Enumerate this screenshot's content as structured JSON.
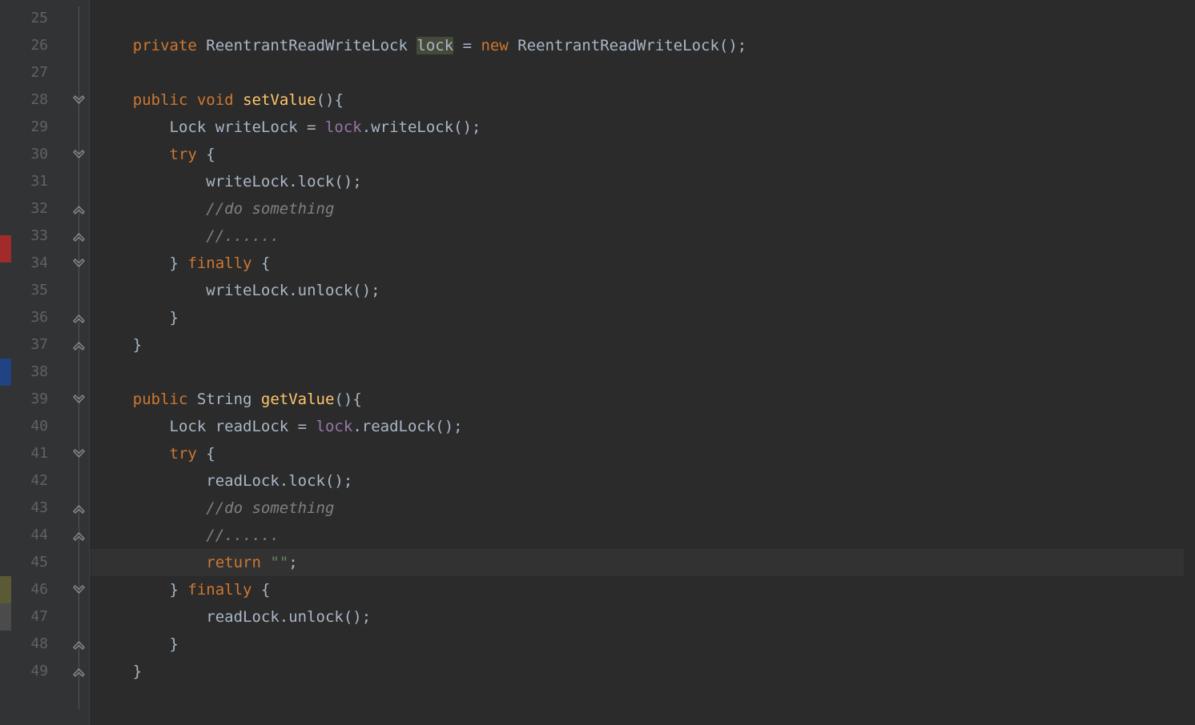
{
  "colors": {
    "keyword": "#cc7832",
    "identifier": "#a9b7c6",
    "function": "#ffc66d",
    "field": "#9876aa",
    "string": "#6a8759",
    "comment": "#808080",
    "highlight_word_bg": "#45493a",
    "line_highlight_bg": "#323232",
    "background": "#2b2b2b",
    "gutter_bg": "#313335"
  },
  "first_line_number": 25,
  "current_line_number": 45,
  "line_numbers": [
    "25",
    "26",
    "27",
    "28",
    "29",
    "30",
    "31",
    "32",
    "33",
    "34",
    "35",
    "36",
    "37",
    "38",
    "39",
    "40",
    "41",
    "42",
    "43",
    "44",
    "45",
    "46",
    "47",
    "48",
    "49"
  ],
  "strip_marks": [
    {
      "type": "red",
      "line": 33
    },
    {
      "type": "blue",
      "line": 38
    },
    {
      "type": "olive",
      "line": 46
    },
    {
      "type": "gray",
      "line": 47
    }
  ],
  "fold_markers": [
    {
      "line": 28,
      "kind": "open"
    },
    {
      "line": 30,
      "kind": "open"
    },
    {
      "line": 32,
      "kind": "close"
    },
    {
      "line": 33,
      "kind": "close"
    },
    {
      "line": 34,
      "kind": "open"
    },
    {
      "line": 36,
      "kind": "close"
    },
    {
      "line": 37,
      "kind": "close"
    },
    {
      "line": 39,
      "kind": "open"
    },
    {
      "line": 41,
      "kind": "open"
    },
    {
      "line": 43,
      "kind": "close"
    },
    {
      "line": 44,
      "kind": "close"
    },
    {
      "line": 46,
      "kind": "open"
    },
    {
      "line": 48,
      "kind": "close"
    },
    {
      "line": 49,
      "kind": "close"
    }
  ],
  "intention_bulb_line": 45,
  "code_lines": [
    {
      "n": 25,
      "tokens": []
    },
    {
      "n": 26,
      "tokens": [
        {
          "t": "    ",
          "c": "id"
        },
        {
          "t": "private",
          "c": "k"
        },
        {
          "t": " ReentrantReadWriteLock ",
          "c": "id"
        },
        {
          "t": "lock",
          "c": "id hlw"
        },
        {
          "t": " = ",
          "c": "id"
        },
        {
          "t": "new",
          "c": "k"
        },
        {
          "t": " ReentrantReadWriteLock();",
          "c": "id"
        }
      ]
    },
    {
      "n": 27,
      "tokens": []
    },
    {
      "n": 28,
      "tokens": [
        {
          "t": "    ",
          "c": "id"
        },
        {
          "t": "public",
          "c": "k"
        },
        {
          "t": " ",
          "c": "id"
        },
        {
          "t": "void",
          "c": "k"
        },
        {
          "t": " ",
          "c": "id"
        },
        {
          "t": "setValue",
          "c": "fn"
        },
        {
          "t": "(){",
          "c": "id"
        }
      ]
    },
    {
      "n": 29,
      "tokens": [
        {
          "t": "        Lock writeLock = ",
          "c": "id"
        },
        {
          "t": "lock",
          "c": "fld"
        },
        {
          "t": ".writeLock();",
          "c": "id"
        }
      ]
    },
    {
      "n": 30,
      "tokens": [
        {
          "t": "        ",
          "c": "id"
        },
        {
          "t": "try",
          "c": "k"
        },
        {
          "t": " {",
          "c": "id"
        }
      ]
    },
    {
      "n": 31,
      "tokens": [
        {
          "t": "            writeLock.lock();",
          "c": "id"
        }
      ]
    },
    {
      "n": 32,
      "tokens": [
        {
          "t": "            ",
          "c": "id"
        },
        {
          "t": "//do something",
          "c": "cm"
        }
      ]
    },
    {
      "n": 33,
      "tokens": [
        {
          "t": "            ",
          "c": "id"
        },
        {
          "t": "//......",
          "c": "cm"
        }
      ]
    },
    {
      "n": 34,
      "tokens": [
        {
          "t": "        } ",
          "c": "id"
        },
        {
          "t": "finally",
          "c": "k"
        },
        {
          "t": " {",
          "c": "id"
        }
      ]
    },
    {
      "n": 35,
      "tokens": [
        {
          "t": "            writeLock.unlock();",
          "c": "id"
        }
      ]
    },
    {
      "n": 36,
      "tokens": [
        {
          "t": "        }",
          "c": "id"
        }
      ]
    },
    {
      "n": 37,
      "tokens": [
        {
          "t": "    }",
          "c": "id"
        }
      ]
    },
    {
      "n": 38,
      "tokens": []
    },
    {
      "n": 39,
      "tokens": [
        {
          "t": "    ",
          "c": "id"
        },
        {
          "t": "public",
          "c": "k"
        },
        {
          "t": " String ",
          "c": "id"
        },
        {
          "t": "getValue",
          "c": "fn"
        },
        {
          "t": "(){",
          "c": "id"
        }
      ]
    },
    {
      "n": 40,
      "tokens": [
        {
          "t": "        Lock readLock = ",
          "c": "id"
        },
        {
          "t": "lock",
          "c": "fld"
        },
        {
          "t": ".readLock();",
          "c": "id"
        }
      ]
    },
    {
      "n": 41,
      "tokens": [
        {
          "t": "        ",
          "c": "id"
        },
        {
          "t": "try",
          "c": "k"
        },
        {
          "t": " {",
          "c": "id"
        }
      ]
    },
    {
      "n": 42,
      "tokens": [
        {
          "t": "            readLock.lock();",
          "c": "id"
        }
      ]
    },
    {
      "n": 43,
      "tokens": [
        {
          "t": "            ",
          "c": "id"
        },
        {
          "t": "//do something",
          "c": "cm"
        }
      ]
    },
    {
      "n": 44,
      "tokens": [
        {
          "t": "            ",
          "c": "id"
        },
        {
          "t": "//......",
          "c": "cm"
        }
      ]
    },
    {
      "n": 45,
      "hl": true,
      "tokens": [
        {
          "t": "            ",
          "c": "id"
        },
        {
          "t": "return",
          "c": "k"
        },
        {
          "t": " ",
          "c": "id"
        },
        {
          "t": "\"\"",
          "c": "str"
        },
        {
          "t": ";",
          "c": "id"
        }
      ]
    },
    {
      "n": 46,
      "tokens": [
        {
          "t": "        } ",
          "c": "id"
        },
        {
          "t": "finally",
          "c": "k"
        },
        {
          "t": " {",
          "c": "id"
        }
      ]
    },
    {
      "n": 47,
      "tokens": [
        {
          "t": "            readLock.unlock();",
          "c": "id"
        }
      ]
    },
    {
      "n": 48,
      "tokens": [
        {
          "t": "        }",
          "c": "id"
        }
      ]
    },
    {
      "n": 49,
      "tokens": [
        {
          "t": "    }",
          "c": "id"
        }
      ]
    }
  ]
}
